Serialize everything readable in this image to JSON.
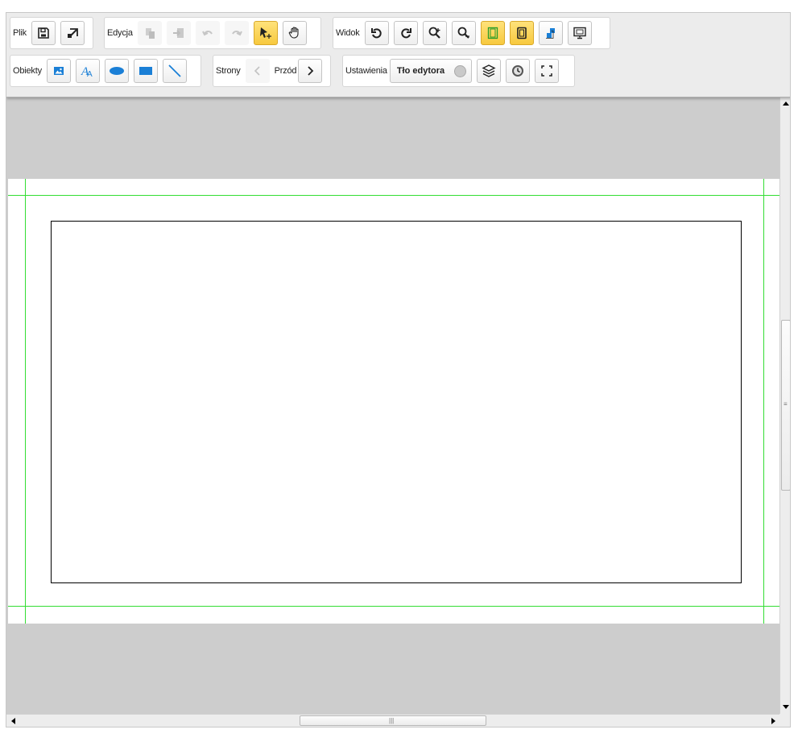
{
  "toolbar": {
    "file": {
      "label": "Plik",
      "save": "save-icon",
      "export": "export-icon"
    },
    "edit": {
      "label": "Edycja"
    },
    "view": {
      "label": "Widok"
    },
    "objects": {
      "label": "Obiekty"
    },
    "pages": {
      "label": "Strony",
      "forward": "Przód"
    },
    "settings": {
      "label": "Ustawienia",
      "editor_background": "Tło edytora"
    }
  },
  "colors": {
    "accent_active": "#f7c93f",
    "icon_blue": "#1a7fd6",
    "guide": "#33dd33",
    "workspace": "#cdcdcd"
  }
}
